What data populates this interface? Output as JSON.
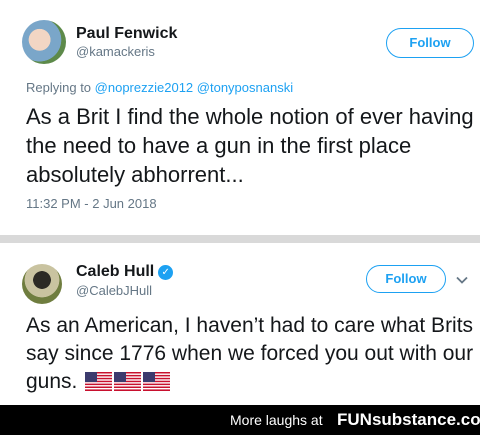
{
  "tweets": [
    {
      "avatar_icon": "user-avatar-icon",
      "name": "Paul Fenwick",
      "handle": "@kamackeris",
      "follow_label": "Follow",
      "replying_prefix": "Replying to",
      "replying_mentions": [
        "@noprezzie2012",
        "@tonyposnanski"
      ],
      "text": "As a Brit I find the whole notion of ever having the need to have a gun in the first place absolutely abhorrent...",
      "timestamp": "11:32 PM - 2 Jun 2018"
    },
    {
      "avatar_icon": "user-avatar-icon",
      "name": "Caleb Hull",
      "verified_icon": "verified-badge-icon",
      "handle": "@CalebJHull",
      "follow_label": "Follow",
      "chevron_icon": "chevron-down-icon",
      "text": "As an American, I haven’t had to care what Brits say since 1776 when we forced you out with our guns.",
      "flags": [
        "us-flag-icon",
        "us-flag-icon",
        "us-flag-icon"
      ]
    }
  ],
  "footer": {
    "more": "More laughs at",
    "brand": "FUNsubstance.com"
  },
  "colors": {
    "accent": "#1da1f2",
    "muted": "#657786",
    "divider": "#d9d9d9"
  }
}
